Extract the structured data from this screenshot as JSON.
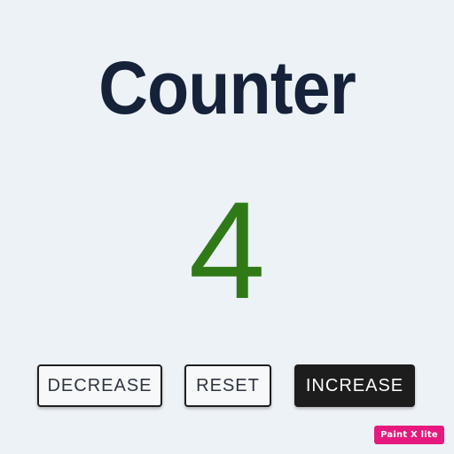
{
  "app": {
    "title": "Counter",
    "count": "4"
  },
  "buttons": {
    "decrease_label": "DECREASE",
    "reset_label": "RESET",
    "increase_label": "INCREASE"
  },
  "watermark": {
    "text": "Paint X lite"
  },
  "colors": {
    "background": "#edf2f7",
    "title": "#15223a",
    "count": "#2f7a17",
    "primary_button": "#1d1d1d",
    "watermark": "#e6197e"
  }
}
